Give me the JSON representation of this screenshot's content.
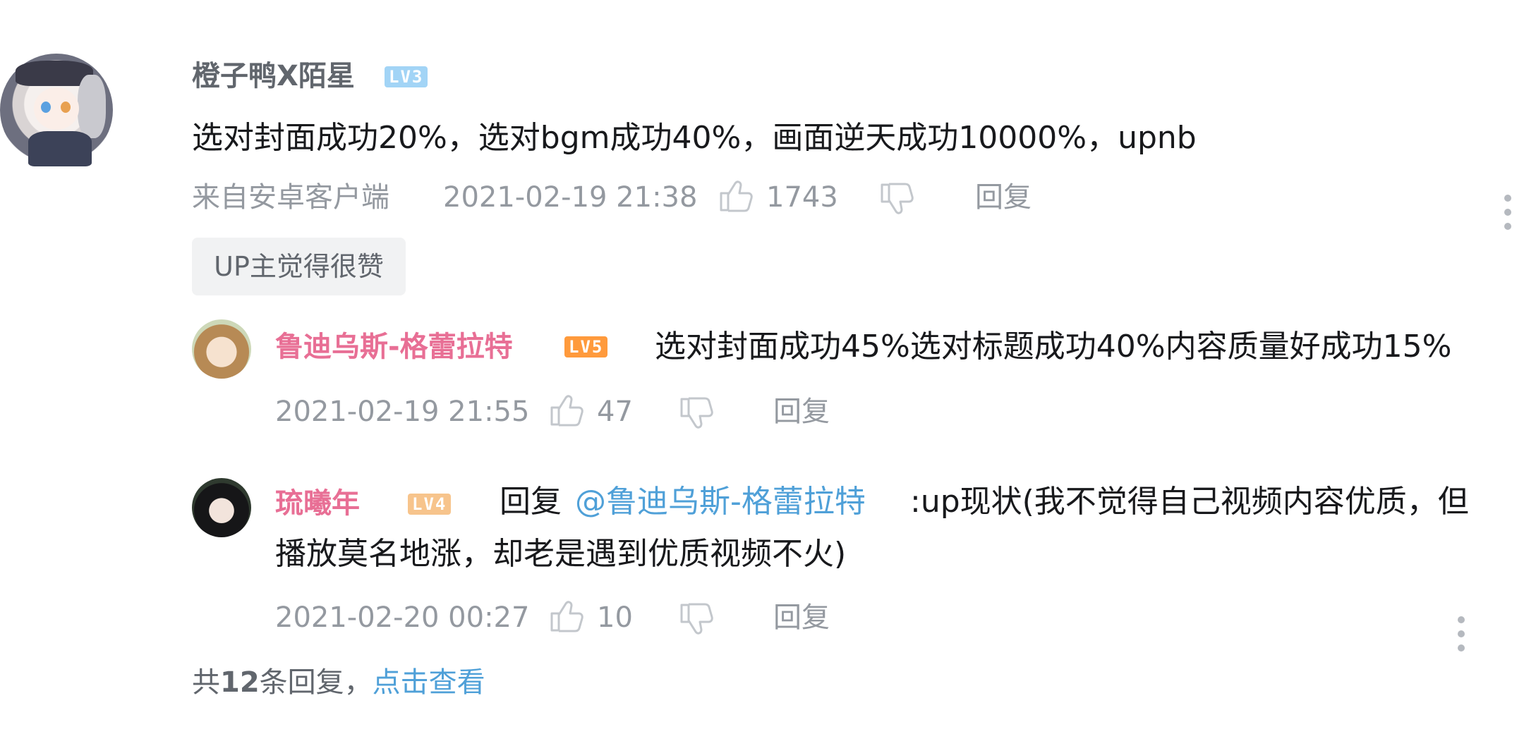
{
  "main_comment": {
    "username": "橙子鸭X陌星",
    "level": "LV3",
    "text": "选对封面成功20%，选对bgm成功40%，画面逆天成功10000%，upnb",
    "source": "来自安卓客户端",
    "time": "2021-02-19 21:38",
    "likes": "1743",
    "reply_label": "回复",
    "up_badge": "UP主觉得很赞"
  },
  "replies": [
    {
      "username": "鲁迪乌斯-格蕾拉特",
      "level": "LV5",
      "text": "选对封面成功45%选对标题成功40%内容质量好成功15%",
      "time": "2021-02-19 21:55",
      "likes": "47",
      "reply_label": "回复"
    },
    {
      "username": "琉曦年",
      "level": "LV4",
      "reply_prefix": "回复",
      "at_user": "@鲁迪乌斯-格蕾拉特",
      "text_line1": ":up现状(我不觉得自己视频内容优质，但",
      "text_line2": "播放莫名地涨，却老是遇到优质视频不火)",
      "time": "2021-02-20 00:27",
      "likes": "10",
      "reply_label": "回复"
    }
  ],
  "footer": {
    "total_prefix": "共",
    "total_count": "12",
    "total_suffix": "条回复，",
    "view_link": "点击查看"
  },
  "colors": {
    "pink_name": "#e86f95",
    "link_blue": "#4fa0d8",
    "meta_gray": "#9499a0"
  }
}
